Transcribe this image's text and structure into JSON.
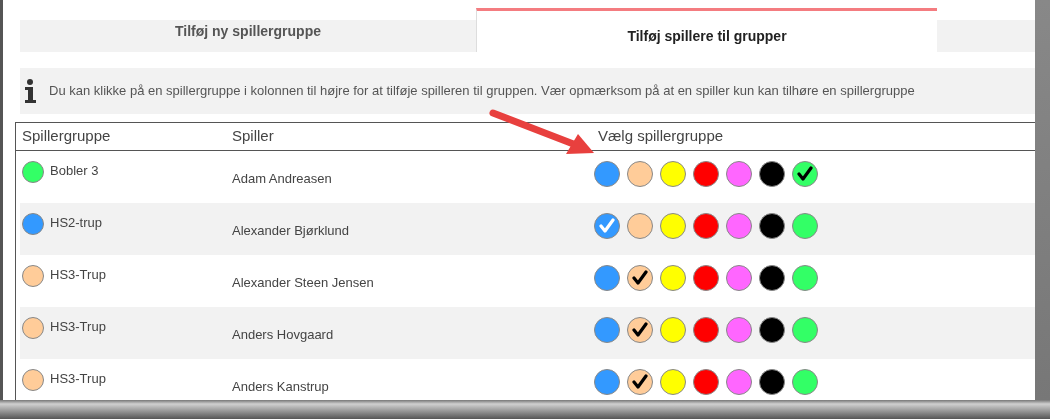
{
  "tabs": [
    {
      "label": "Tilføj ny spillergruppe",
      "selected": false
    },
    {
      "label": "Tilføj spillere til grupper",
      "selected": true
    }
  ],
  "info": {
    "text": "Du kan klikke på en spillergruppe i kolonnen til højre for at tilføje spilleren til gruppen. Vær opmærksom på at en spiller kun kan tilhøre en spillergruppe"
  },
  "table": {
    "columns": [
      "Spillergruppe",
      "Spiller",
      "Vælg spillergruppe"
    ],
    "rows": [
      {
        "group": "Bobler 3",
        "color": "#33ff66",
        "player": "Adam Andreasen",
        "choices": [
          {
            "color": "#3399ff",
            "selected": false
          },
          {
            "color": "#ffcc99",
            "selected": false
          },
          {
            "color": "#ffff00",
            "selected": false
          },
          {
            "color": "#ff0000",
            "selected": false
          },
          {
            "color": "#ff66ff",
            "selected": false
          },
          {
            "color": "#000000",
            "selected": false
          },
          {
            "color": "#33ff66",
            "selected": true
          }
        ]
      },
      {
        "group": "HS2-trup",
        "color": "#3399ff",
        "player": "Alexander Bjørklund",
        "choices": [
          {
            "color": "#3399ff",
            "selected": true
          },
          {
            "color": "#ffcc99",
            "selected": false
          },
          {
            "color": "#ffff00",
            "selected": false
          },
          {
            "color": "#ff0000",
            "selected": false
          },
          {
            "color": "#ff66ff",
            "selected": false
          },
          {
            "color": "#000000",
            "selected": false
          },
          {
            "color": "#33ff66",
            "selected": false
          }
        ]
      },
      {
        "group": "HS3-Trup",
        "color": "#ffcc99",
        "player": "Alexander Steen Jensen",
        "choices": [
          {
            "color": "#3399ff",
            "selected": false
          },
          {
            "color": "#ffcc99",
            "selected": true
          },
          {
            "color": "#ffff00",
            "selected": false
          },
          {
            "color": "#ff0000",
            "selected": false
          },
          {
            "color": "#ff66ff",
            "selected": false
          },
          {
            "color": "#000000",
            "selected": false
          },
          {
            "color": "#33ff66",
            "selected": false
          }
        ]
      },
      {
        "group": "HS3-Trup",
        "color": "#ffcc99",
        "player": "Anders Hovgaard",
        "choices": [
          {
            "color": "#3399ff",
            "selected": false
          },
          {
            "color": "#ffcc99",
            "selected": true
          },
          {
            "color": "#ffff00",
            "selected": false
          },
          {
            "color": "#ff0000",
            "selected": false
          },
          {
            "color": "#ff66ff",
            "selected": false
          },
          {
            "color": "#000000",
            "selected": false
          },
          {
            "color": "#33ff66",
            "selected": false
          }
        ]
      },
      {
        "group": "HS3-Trup",
        "color": "#ffcc99",
        "player": "Anders Kanstrup",
        "choices": [
          {
            "color": "#3399ff",
            "selected": false
          },
          {
            "color": "#ffcc99",
            "selected": true
          },
          {
            "color": "#ffff00",
            "selected": false
          },
          {
            "color": "#ff0000",
            "selected": false
          },
          {
            "color": "#ff66ff",
            "selected": false
          },
          {
            "color": "#000000",
            "selected": false
          },
          {
            "color": "#33ff66",
            "selected": false
          }
        ]
      }
    ]
  }
}
